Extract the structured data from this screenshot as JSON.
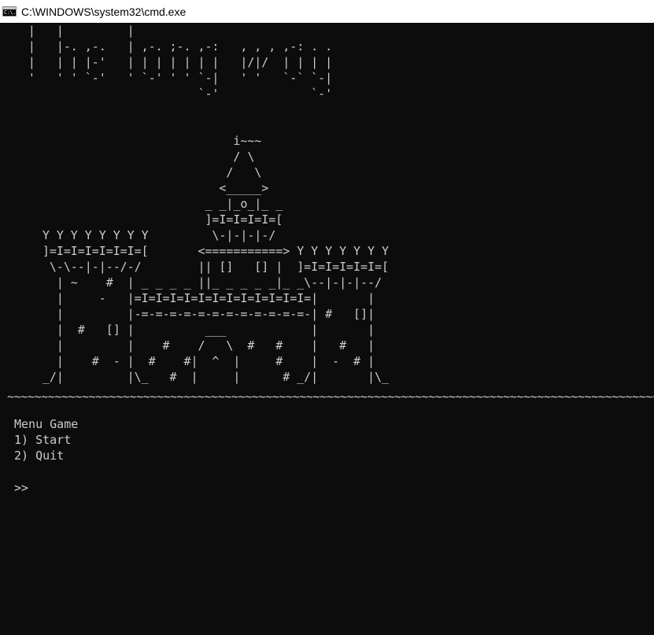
{
  "window": {
    "title": "C:\\WINDOWS\\system32\\cmd.exe",
    "icon_label": "C:\\."
  },
  "console": {
    "ascii_art": "    |   |         |\n    |   |-. ,-.   | ,-. ;-. ,-:   , , , ,-: . .\n    |   | | |-'   | | | | | | |   |/|/  | | | |\n    '   ' ' `-'   ' `-' ' ' `-|   ' '   `-` `-|\n                            `-'             `-'\n\n\n                                 i~~~\n                                 / \\\n                                /   \\\n                               <_____>\n                             _ _|_o_|_ _\n                             ]=I=I=I=I=[\n      Y Y Y Y Y Y Y Y         \\-|-|-|-/\n      ]=I=I=I=I=I=I=[       <===========> Y Y Y Y Y Y Y\n       \\-\\--|-|--/-/        || []   [] |  ]=I=I=I=I=I=[\n        | ~    #  | _ _ _ _ ||_ _ _ _ _|_ _\\--|-|-|--/\n        |     -   |=I=I=I=I=I=I=I=I=I=I=I=I=|       |\n        |         |-=-=-=-=-=-=-=-=-=-=-=-=-| #   []|\n        |  #   [] |          ___            |       |\n        |         |    #    /   \\  #   #    |   #   |\n        |    #  - |  #    #|  ^  |     #    |  -  # |\n      _/|         |\\_   #  |     |      # _/|       |\\_",
    "separator": "~~~~~~~~~~~~~~~~~~~~~~~~~~~~~~~~~~~~~~~~~~~~~~~~~~~~~~~~~~~~~~~~~~~~~~~~~~~~~~~~~~~~~~~~~~~~~~~~~~~~~~~~~~~~~~~~~~~~~~~~~~~~~~~~~~~~~~~~~~~~~~~~~~~~~~~~",
    "menu": {
      "title": "Menu Game",
      "options": [
        "1) Start",
        "2) Quit"
      ]
    },
    "prompt": ">>"
  },
  "colors": {
    "background": "#0c0c0c",
    "text": "#cccccc",
    "separator": "#3b78ff",
    "titlebar": "#ffffff"
  }
}
